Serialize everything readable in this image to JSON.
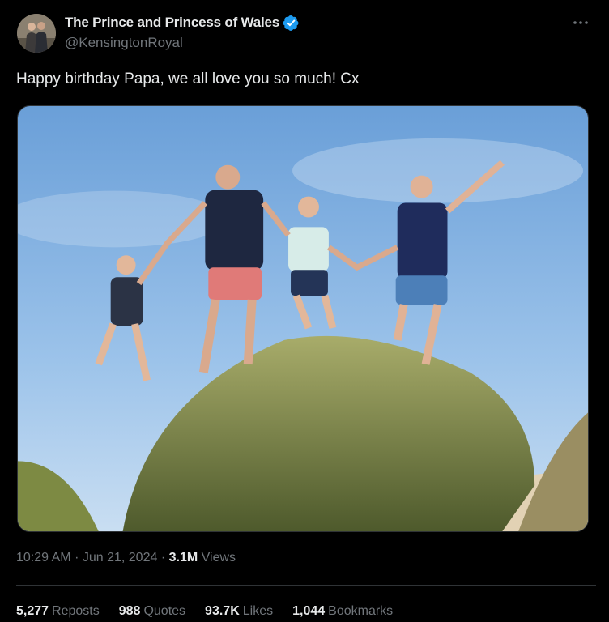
{
  "author": {
    "display_name": "The Prince and Princess of Wales",
    "handle": "@KensingtonRoyal",
    "verified": true
  },
  "tweet": {
    "text": "Happy birthday Papa, we all love you so much! Cx",
    "time": "10:29 AM",
    "date": "Jun 21, 2024",
    "views_count": "3.1M",
    "views_label": "Views"
  },
  "stats": {
    "reposts_count": "5,277",
    "reposts_label": "Reposts",
    "quotes_count": "988",
    "quotes_label": "Quotes",
    "likes_count": "93.7K",
    "likes_label": "Likes",
    "bookmarks_count": "1,044",
    "bookmarks_label": "Bookmarks"
  },
  "colors": {
    "background": "#000000",
    "primary_text": "#e7e9ea",
    "secondary_text": "#71767b",
    "verified_badge": "#1d9bf0",
    "divider": "#2f3336"
  },
  "icons": [
    "verified-badge-icon",
    "more-options-icon"
  ]
}
